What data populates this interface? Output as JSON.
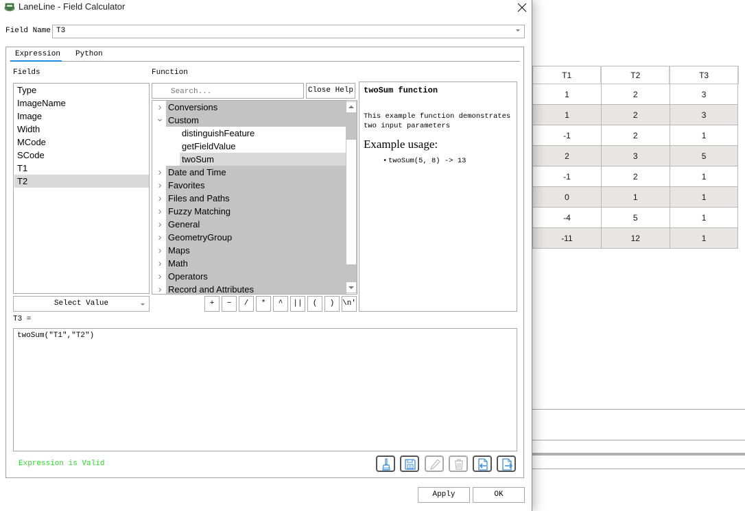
{
  "window": {
    "title": "LaneLine - Field Calculator",
    "close_label": "✕"
  },
  "field_name": {
    "label": "Field Name",
    "value": "T3"
  },
  "tabs": [
    {
      "label": "Expression",
      "active": true
    },
    {
      "label": "Python",
      "active": false
    }
  ],
  "fields_panel": {
    "label": "Fields",
    "items": [
      "Type",
      "ImageName",
      "Image",
      "Width",
      "MCode",
      "SCode",
      "T1",
      "T2"
    ],
    "selected": "T2",
    "select_value_label": "Select Value"
  },
  "function_panel": {
    "label": "Function",
    "search_placeholder": "Search...",
    "close_help_label": "Close Help",
    "tree": [
      {
        "label": "Conversions",
        "expanded": false
      },
      {
        "label": "Custom",
        "expanded": true,
        "children": [
          "distinguishFeature",
          "getFieldValue",
          "twoSum"
        ]
      },
      {
        "label": "Date and Time",
        "expanded": false
      },
      {
        "label": "Favorites",
        "expanded": false
      },
      {
        "label": "Files and Paths",
        "expanded": false
      },
      {
        "label": "Fuzzy Matching",
        "expanded": false
      },
      {
        "label": "General",
        "expanded": false
      },
      {
        "label": "GeometryGroup",
        "expanded": false
      },
      {
        "label": "Maps",
        "expanded": false
      },
      {
        "label": "Math",
        "expanded": false
      },
      {
        "label": "Operators",
        "expanded": false
      },
      {
        "label": "Record and Attributes",
        "expanded": false
      }
    ],
    "selected_function": "twoSum",
    "operators": [
      "+",
      "−",
      "/",
      "*",
      "^",
      "||",
      "(",
      ")",
      "\\n'"
    ]
  },
  "help": {
    "title": "twoSum function",
    "description": "This example function demonstrates two input parameters",
    "usage_title": "Example usage:",
    "usage_items": [
      "twoSum(5, 8) -> 13"
    ]
  },
  "expression": {
    "label": "T3 =",
    "value": "twoSum(\"T1\",\"T2\")",
    "status": "Expression is Valid",
    "status_color": "#22dd22"
  },
  "toolbar": {
    "buttons": [
      {
        "name": "clear",
        "icon": "broom-icon",
        "enabled": true
      },
      {
        "name": "save",
        "icon": "floppy-icon",
        "enabled": true
      },
      {
        "name": "edit",
        "icon": "pencil-icon",
        "enabled": false
      },
      {
        "name": "delete",
        "icon": "trash-icon",
        "enabled": false
      },
      {
        "name": "import",
        "icon": "file-import-icon",
        "enabled": true
      },
      {
        "name": "export",
        "icon": "file-export-icon",
        "enabled": true
      }
    ],
    "icon_color": "#3c8fe0"
  },
  "dialog_buttons": {
    "apply": "Apply",
    "ok": "OK"
  },
  "attribute_table": {
    "columns": [
      "T1",
      "T2",
      "T3"
    ],
    "rows": [
      [
        "1",
        "2",
        "3"
      ],
      [
        "1",
        "2",
        "3"
      ],
      [
        "-1",
        "2",
        "1"
      ],
      [
        "2",
        "3",
        "5"
      ],
      [
        "-1",
        "2",
        "1"
      ],
      [
        "0",
        "1",
        "1"
      ],
      [
        "-4",
        "5",
        "1"
      ],
      [
        "-11",
        "12",
        "1"
      ]
    ]
  }
}
